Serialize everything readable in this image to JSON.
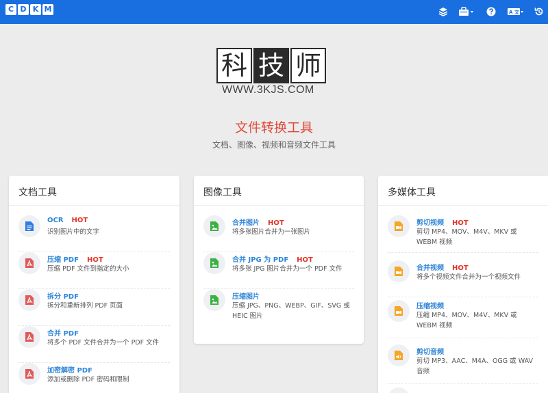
{
  "brand": {
    "letters": [
      "C",
      "D",
      "K",
      "M"
    ]
  },
  "logo": {
    "chars": [
      "科",
      "技",
      "师"
    ],
    "url": "WWW.3KJS.COM"
  },
  "hero": {
    "title": "文件转换工具",
    "subtitle": "文档、图像、视频和音频文件工具"
  },
  "colors": {
    "topbar": "#1a6fe0",
    "link": "#2f86d8",
    "hot": "#e0352b",
    "pdf": "#e05a5a",
    "doc": "#2f7be0",
    "image": "#3cb043",
    "media": "#f5a623"
  },
  "cards": [
    {
      "title": "文档工具",
      "items": [
        {
          "name": "OCR",
          "hot": "HOT",
          "desc": "识别图片中的文字",
          "icon": "document-icon"
        },
        {
          "name": "压缩 PDF",
          "hot": "HOT",
          "desc": "压缩 PDF 文件到指定的大小",
          "icon": "pdf-icon"
        },
        {
          "name": "拆分 PDF",
          "hot": "",
          "desc": "拆分和重新排列 PDF 页面",
          "icon": "pdf-icon"
        },
        {
          "name": "合并 PDF",
          "hot": "",
          "desc": "将多个 PDF 文件合并为一个 PDF 文件",
          "icon": "pdf-icon"
        },
        {
          "name": "加密解密 PDF",
          "hot": "",
          "desc": "添加或删除 PDF 密码和限制",
          "icon": "pdf-icon"
        }
      ]
    },
    {
      "title": "图像工具",
      "items": [
        {
          "name": "合并图片",
          "hot": "HOT",
          "desc": "将多张图片合并为一张图片",
          "icon": "image-icon"
        },
        {
          "name": "合并 JPG 为 PDF",
          "hot": "HOT",
          "desc": "将多张 JPG 图片合并为一个 PDF 文件",
          "icon": "image-icon"
        },
        {
          "name": "压缩图片",
          "hot": "",
          "desc": "压缩 JPG、PNG、WEBP、GIF、SVG 或 HEIC 图片",
          "icon": "image-icon"
        }
      ]
    },
    {
      "title": "多媒体工具",
      "items": [
        {
          "name": "剪切视频",
          "hot": "HOT",
          "desc": "剪切 MP4、MOV、M4V、MKV 或 WEBM 视频",
          "icon": "video-icon"
        },
        {
          "name": "合并视频",
          "hot": "HOT",
          "desc": "将多个视频文件合并为一个视频文件",
          "icon": "video-icon"
        },
        {
          "name": "压缩视频",
          "hot": "",
          "desc": "压缩 MP4、MOV、M4V、MKV 或 WEBM 视频",
          "icon": "video-icon"
        },
        {
          "name": "剪切音频",
          "hot": "",
          "desc": "剪切 MP3、AAC、M4A、OGG 或 WAV 音频",
          "icon": "audio-icon"
        }
      ]
    }
  ]
}
